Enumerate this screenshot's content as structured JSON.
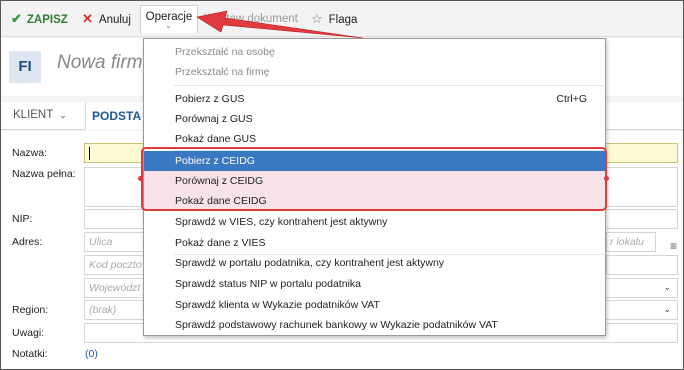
{
  "toolbar": {
    "save_label": "ZAPISZ",
    "cancel_label": "Anuluj",
    "operations_label": "Operacje",
    "issue_document_label": "Wystaw dokument",
    "flag_label": "Flaga"
  },
  "header": {
    "logo_text": "FI",
    "title": "Nowa firm"
  },
  "tabs": {
    "client_label": "KLIENT",
    "basic_label": "PODSTA"
  },
  "form": {
    "labels": {
      "name": "Nazwa:",
      "full_name": "Nazwa pełna:",
      "nip": "NIP:",
      "address": "Adres:",
      "region": "Region:",
      "remarks": "Uwagi:",
      "notes": "Notatki:"
    },
    "placeholders": {
      "street": "Ulica",
      "postal_code": "Kod poczto",
      "voivodeship": "Województ",
      "region": "(brak)",
      "local_number": "r lokalu"
    },
    "notes_count": "(0)"
  },
  "menu": {
    "items": [
      {
        "label": "Przekształć na osobę",
        "disabled": true
      },
      {
        "label": "Przekształć na firmę",
        "disabled": true
      },
      {
        "label": "Pobierz z GUS",
        "shortcut": "Ctrl+G"
      },
      {
        "label": "Porównaj z GUS"
      },
      {
        "label": "Pokaż dane GUS"
      },
      {
        "label": "Pobierz z CEIDG",
        "highlighted": true
      },
      {
        "label": "Porównaj z CEIDG"
      },
      {
        "label": "Pokaż dane CEIDG"
      },
      {
        "label": "Sprawdź w VIES, czy kontrahent jest aktywny"
      },
      {
        "label": "Pokaż dane z VIES"
      },
      {
        "label": "Sprawdź w portalu podatnika, czy kontrahent jest aktywny"
      },
      {
        "label": "Sprawdź status NIP w portalu podatnika"
      },
      {
        "label": "Sprawdź klienta w Wykazie podatników VAT"
      },
      {
        "label": "Sprawdź podstawowy rachunek bankowy w Wykazie podatników VAT"
      }
    ]
  },
  "colors": {
    "save_green": "#2e7d32",
    "cancel_red": "#d32f2f",
    "highlight_blue": "#3a78c2",
    "annotation_red": "#e0393e",
    "link_blue": "#1a5a9a"
  }
}
